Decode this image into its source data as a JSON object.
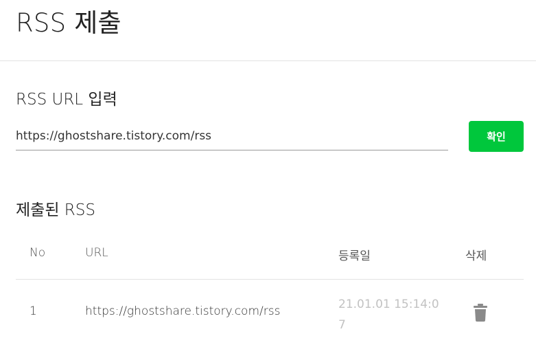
{
  "header": {
    "title": "RSS 제출"
  },
  "input_section": {
    "title": "RSS URL 입력",
    "url_value": "https://ghostshare.tistory.com/rss",
    "confirm_label": "확인"
  },
  "list_section": {
    "title": "제출된 RSS",
    "columns": {
      "no": "No",
      "url": "URL",
      "date": "등록일",
      "delete": "삭제"
    },
    "rows": [
      {
        "no": "1",
        "url": "https://ghostshare.tistory.com/rss",
        "date": "21.01.01 15:14:07",
        "delete_icon": "trash-icon"
      }
    ]
  },
  "colors": {
    "accent": "#00c73c",
    "muted_text": "#c2c2c2"
  }
}
